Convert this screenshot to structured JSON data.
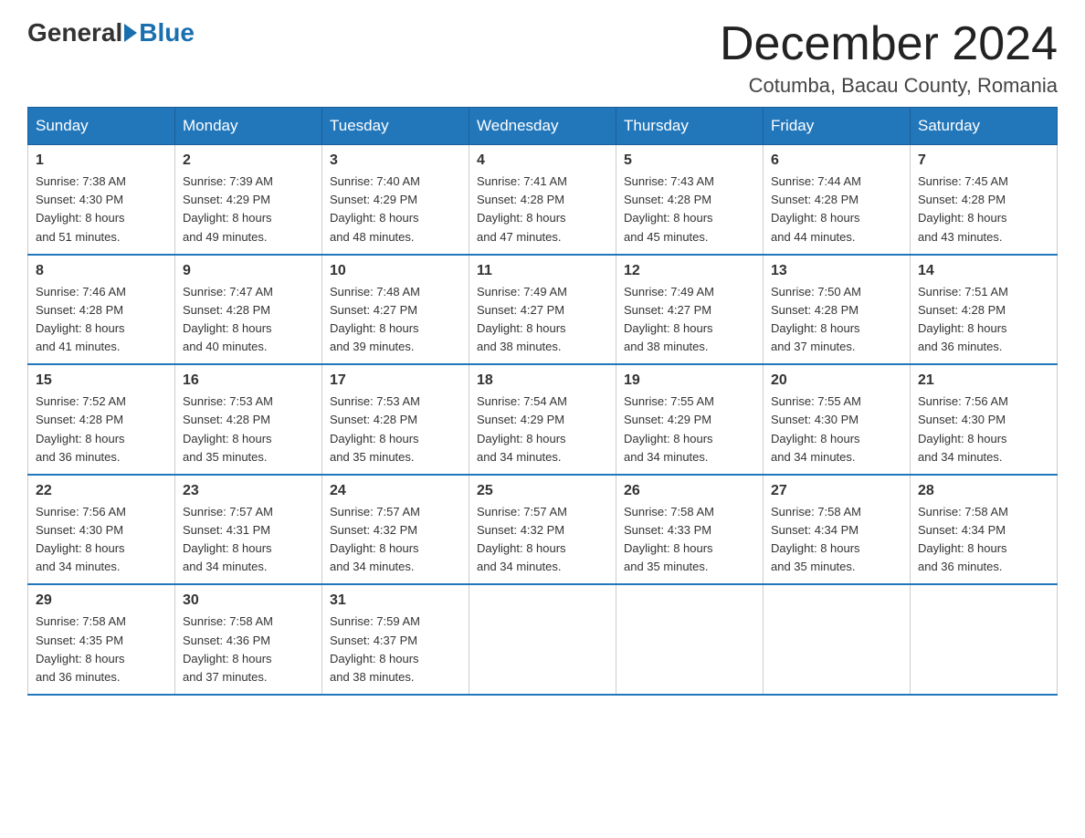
{
  "header": {
    "logo_general": "General",
    "logo_blue": "Blue",
    "month_title": "December 2024",
    "location": "Cotumba, Bacau County, Romania"
  },
  "days_of_week": [
    "Sunday",
    "Monday",
    "Tuesday",
    "Wednesday",
    "Thursday",
    "Friday",
    "Saturday"
  ],
  "weeks": [
    [
      {
        "day": "1",
        "sunrise": "7:38 AM",
        "sunset": "4:30 PM",
        "daylight": "8 hours and 51 minutes."
      },
      {
        "day": "2",
        "sunrise": "7:39 AM",
        "sunset": "4:29 PM",
        "daylight": "8 hours and 49 minutes."
      },
      {
        "day": "3",
        "sunrise": "7:40 AM",
        "sunset": "4:29 PM",
        "daylight": "8 hours and 48 minutes."
      },
      {
        "day": "4",
        "sunrise": "7:41 AM",
        "sunset": "4:28 PM",
        "daylight": "8 hours and 47 minutes."
      },
      {
        "day": "5",
        "sunrise": "7:43 AM",
        "sunset": "4:28 PM",
        "daylight": "8 hours and 45 minutes."
      },
      {
        "day": "6",
        "sunrise": "7:44 AM",
        "sunset": "4:28 PM",
        "daylight": "8 hours and 44 minutes."
      },
      {
        "day": "7",
        "sunrise": "7:45 AM",
        "sunset": "4:28 PM",
        "daylight": "8 hours and 43 minutes."
      }
    ],
    [
      {
        "day": "8",
        "sunrise": "7:46 AM",
        "sunset": "4:28 PM",
        "daylight": "8 hours and 41 minutes."
      },
      {
        "day": "9",
        "sunrise": "7:47 AM",
        "sunset": "4:28 PM",
        "daylight": "8 hours and 40 minutes."
      },
      {
        "day": "10",
        "sunrise": "7:48 AM",
        "sunset": "4:27 PM",
        "daylight": "8 hours and 39 minutes."
      },
      {
        "day": "11",
        "sunrise": "7:49 AM",
        "sunset": "4:27 PM",
        "daylight": "8 hours and 38 minutes."
      },
      {
        "day": "12",
        "sunrise": "7:49 AM",
        "sunset": "4:27 PM",
        "daylight": "8 hours and 38 minutes."
      },
      {
        "day": "13",
        "sunrise": "7:50 AM",
        "sunset": "4:28 PM",
        "daylight": "8 hours and 37 minutes."
      },
      {
        "day": "14",
        "sunrise": "7:51 AM",
        "sunset": "4:28 PM",
        "daylight": "8 hours and 36 minutes."
      }
    ],
    [
      {
        "day": "15",
        "sunrise": "7:52 AM",
        "sunset": "4:28 PM",
        "daylight": "8 hours and 36 minutes."
      },
      {
        "day": "16",
        "sunrise": "7:53 AM",
        "sunset": "4:28 PM",
        "daylight": "8 hours and 35 minutes."
      },
      {
        "day": "17",
        "sunrise": "7:53 AM",
        "sunset": "4:28 PM",
        "daylight": "8 hours and 35 minutes."
      },
      {
        "day": "18",
        "sunrise": "7:54 AM",
        "sunset": "4:29 PM",
        "daylight": "8 hours and 34 minutes."
      },
      {
        "day": "19",
        "sunrise": "7:55 AM",
        "sunset": "4:29 PM",
        "daylight": "8 hours and 34 minutes."
      },
      {
        "day": "20",
        "sunrise": "7:55 AM",
        "sunset": "4:30 PM",
        "daylight": "8 hours and 34 minutes."
      },
      {
        "day": "21",
        "sunrise": "7:56 AM",
        "sunset": "4:30 PM",
        "daylight": "8 hours and 34 minutes."
      }
    ],
    [
      {
        "day": "22",
        "sunrise": "7:56 AM",
        "sunset": "4:30 PM",
        "daylight": "8 hours and 34 minutes."
      },
      {
        "day": "23",
        "sunrise": "7:57 AM",
        "sunset": "4:31 PM",
        "daylight": "8 hours and 34 minutes."
      },
      {
        "day": "24",
        "sunrise": "7:57 AM",
        "sunset": "4:32 PM",
        "daylight": "8 hours and 34 minutes."
      },
      {
        "day": "25",
        "sunrise": "7:57 AM",
        "sunset": "4:32 PM",
        "daylight": "8 hours and 34 minutes."
      },
      {
        "day": "26",
        "sunrise": "7:58 AM",
        "sunset": "4:33 PM",
        "daylight": "8 hours and 35 minutes."
      },
      {
        "day": "27",
        "sunrise": "7:58 AM",
        "sunset": "4:34 PM",
        "daylight": "8 hours and 35 minutes."
      },
      {
        "day": "28",
        "sunrise": "7:58 AM",
        "sunset": "4:34 PM",
        "daylight": "8 hours and 36 minutes."
      }
    ],
    [
      {
        "day": "29",
        "sunrise": "7:58 AM",
        "sunset": "4:35 PM",
        "daylight": "8 hours and 36 minutes."
      },
      {
        "day": "30",
        "sunrise": "7:58 AM",
        "sunset": "4:36 PM",
        "daylight": "8 hours and 37 minutes."
      },
      {
        "day": "31",
        "sunrise": "7:59 AM",
        "sunset": "4:37 PM",
        "daylight": "8 hours and 38 minutes."
      },
      null,
      null,
      null,
      null
    ]
  ],
  "labels": {
    "sunrise_prefix": "Sunrise: ",
    "sunset_prefix": "Sunset: ",
    "daylight_prefix": "Daylight: "
  }
}
